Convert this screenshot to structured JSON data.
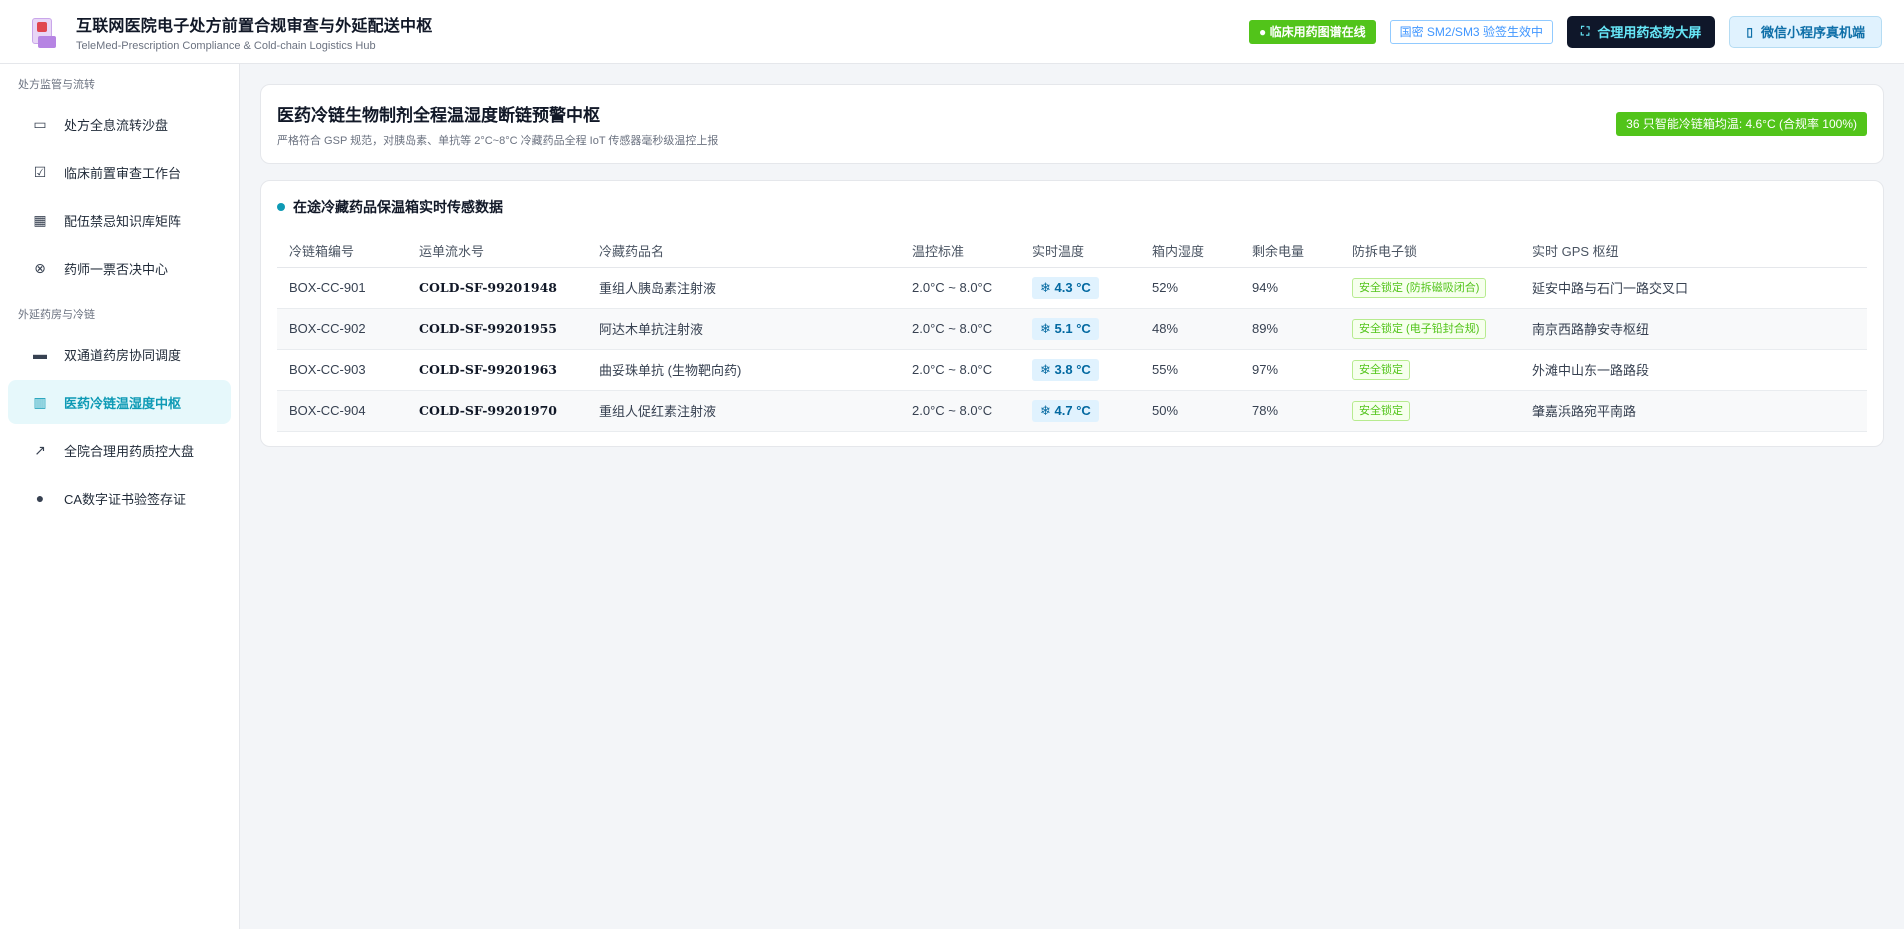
{
  "header": {
    "title": "互联网医院电子处方前置合规审查与外延配送中枢",
    "subtitle": "TeleMed-Prescription Compliance & Cold-chain Logistics Hub",
    "online_pill": "● 临床用药图谱在线",
    "sign_pill": "国密 SM2/SM3 验签生效中",
    "bigscreen_button": "合理用药态势大屏",
    "bigscreen_icon": "fullscreen-icon",
    "miniapp_button": "微信小程序真机端",
    "miniapp_icon": "phone-icon"
  },
  "sidebar": {
    "groups": [
      {
        "label": "处方监管与流转",
        "items": [
          {
            "label": "处方全息流转沙盘",
            "icon": "presentation-board-icon",
            "active": false
          },
          {
            "label": "临床前置审查工作台",
            "icon": "file-check-icon",
            "active": false
          },
          {
            "label": "配伍禁忌知识库矩阵",
            "icon": "grid-icon",
            "active": false
          },
          {
            "label": "药师一票否决中心",
            "icon": "close-circle-icon",
            "active": false
          }
        ]
      },
      {
        "label": "外延药房与冷链",
        "items": [
          {
            "label": "双通道药房协同调度",
            "icon": "desktop-icon",
            "active": false
          },
          {
            "label": "医药冷链温湿度中枢",
            "icon": "fridge-icon",
            "active": true
          },
          {
            "label": "全院合理用药质控大盘",
            "icon": "line-chart-icon",
            "active": false
          },
          {
            "label": "CA数字证书验签存证",
            "icon": "user-icon",
            "active": false
          }
        ]
      }
    ]
  },
  "panel": {
    "title": "医药冷链生物制剂全程温湿度断链预警中枢",
    "subtitle": "严格符合 GSP 规范，对胰岛素、单抗等 2°C~8°C 冷藏药品全程 IoT 传感器毫秒级温控上报",
    "status": "36 只智能冷链箱均温: 4.6°C (合规率 100%)"
  },
  "table": {
    "section_title": "在途冷藏药品保温箱实时传感数据",
    "columns": [
      "冷链箱编号",
      "运单流水号",
      "冷藏药品名",
      "温控标准",
      "实时温度",
      "箱内湿度",
      "剩余电量",
      "防拆电子锁",
      "实时 GPS 枢纽"
    ],
    "rows": [
      {
        "box": "BOX-CC-901",
        "waybill": "COLD-SF-99201948",
        "drug": "重组人胰岛素注射液",
        "range": "2.0°C ~ 8.0°C",
        "temp": "❄ 4.3 °C",
        "humidity": "52%",
        "battery": "94%",
        "lock": "安全锁定 (防拆磁吸闭合)",
        "gps": "延安中路与石门一路交叉口"
      },
      {
        "box": "BOX-CC-902",
        "waybill": "COLD-SF-99201955",
        "drug": "阿达木单抗注射液",
        "range": "2.0°C ~ 8.0°C",
        "temp": "❄ 5.1 °C",
        "humidity": "48%",
        "battery": "89%",
        "lock": "安全锁定 (电子铅封合规)",
        "gps": "南京西路静安寺枢纽"
      },
      {
        "box": "BOX-CC-903",
        "waybill": "COLD-SF-99201963",
        "drug": "曲妥珠单抗 (生物靶向药)",
        "range": "2.0°C ~ 8.0°C",
        "temp": "❄ 3.8 °C",
        "humidity": "55%",
        "battery": "97%",
        "lock": "安全锁定",
        "gps": "外滩中山东一路路段"
      },
      {
        "box": "BOX-CC-904",
        "waybill": "COLD-SF-99201970",
        "drug": "重组人促红素注射液",
        "range": "2.0°C ~ 8.0°C",
        "temp": "❄ 4.7 °C",
        "humidity": "50%",
        "battery": "78%",
        "lock": "安全锁定",
        "gps": "肇嘉浜路宛平南路"
      }
    ]
  }
}
